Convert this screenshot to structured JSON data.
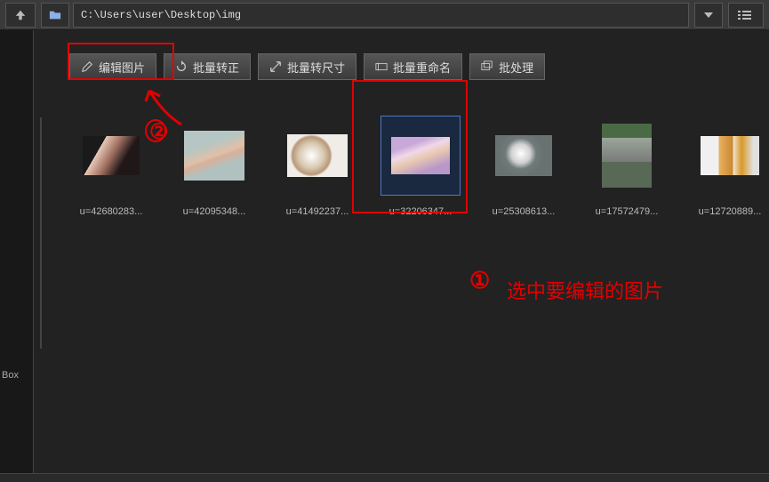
{
  "path": "C:\\Users\\user\\Desktop\\img",
  "toolbar": {
    "edit_image": "编辑图片",
    "batch_rotate": "批量转正",
    "batch_resize": "批量转尺寸",
    "batch_rename": "批量重命名",
    "batch_process": "批处理"
  },
  "thumbs": [
    {
      "label": "u=42680283..."
    },
    {
      "label": "u=42095348..."
    },
    {
      "label": "u=41492237..."
    },
    {
      "label": "u=32206347..."
    },
    {
      "label": "u=25308613..."
    },
    {
      "label": "u=17572479..."
    },
    {
      "label": "u=12720889..."
    }
  ],
  "selected_index": 3,
  "sidebar": {
    "text": "Box"
  },
  "annotations": {
    "instruction": "选中要编辑的图片",
    "step1": "①",
    "step2": "②"
  }
}
